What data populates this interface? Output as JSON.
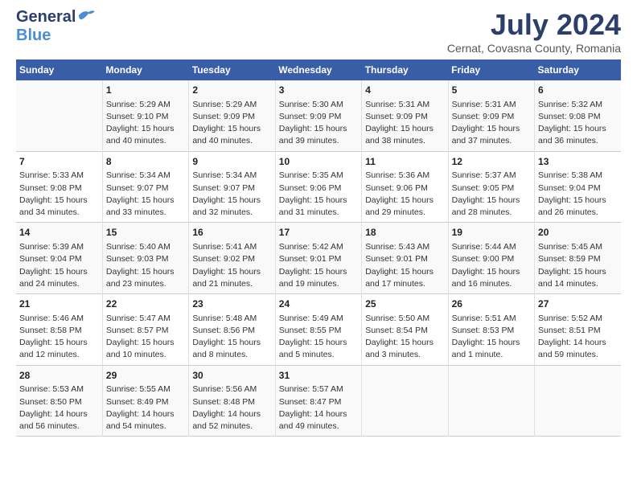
{
  "header": {
    "logo_general": "General",
    "logo_blue": "Blue",
    "title": "July 2024",
    "subtitle": "Cernat, Covasna County, Romania"
  },
  "weekdays": [
    "Sunday",
    "Monday",
    "Tuesday",
    "Wednesday",
    "Thursday",
    "Friday",
    "Saturday"
  ],
  "weeks": [
    [
      {
        "num": "",
        "sunrise": "",
        "sunset": "",
        "daylight": ""
      },
      {
        "num": "1",
        "sunrise": "Sunrise: 5:29 AM",
        "sunset": "Sunset: 9:10 PM",
        "daylight": "Daylight: 15 hours and 40 minutes."
      },
      {
        "num": "2",
        "sunrise": "Sunrise: 5:29 AM",
        "sunset": "Sunset: 9:09 PM",
        "daylight": "Daylight: 15 hours and 40 minutes."
      },
      {
        "num": "3",
        "sunrise": "Sunrise: 5:30 AM",
        "sunset": "Sunset: 9:09 PM",
        "daylight": "Daylight: 15 hours and 39 minutes."
      },
      {
        "num": "4",
        "sunrise": "Sunrise: 5:31 AM",
        "sunset": "Sunset: 9:09 PM",
        "daylight": "Daylight: 15 hours and 38 minutes."
      },
      {
        "num": "5",
        "sunrise": "Sunrise: 5:31 AM",
        "sunset": "Sunset: 9:09 PM",
        "daylight": "Daylight: 15 hours and 37 minutes."
      },
      {
        "num": "6",
        "sunrise": "Sunrise: 5:32 AM",
        "sunset": "Sunset: 9:08 PM",
        "daylight": "Daylight: 15 hours and 36 minutes."
      }
    ],
    [
      {
        "num": "7",
        "sunrise": "Sunrise: 5:33 AM",
        "sunset": "Sunset: 9:08 PM",
        "daylight": "Daylight: 15 hours and 34 minutes."
      },
      {
        "num": "8",
        "sunrise": "Sunrise: 5:34 AM",
        "sunset": "Sunset: 9:07 PM",
        "daylight": "Daylight: 15 hours and 33 minutes."
      },
      {
        "num": "9",
        "sunrise": "Sunrise: 5:34 AM",
        "sunset": "Sunset: 9:07 PM",
        "daylight": "Daylight: 15 hours and 32 minutes."
      },
      {
        "num": "10",
        "sunrise": "Sunrise: 5:35 AM",
        "sunset": "Sunset: 9:06 PM",
        "daylight": "Daylight: 15 hours and 31 minutes."
      },
      {
        "num": "11",
        "sunrise": "Sunrise: 5:36 AM",
        "sunset": "Sunset: 9:06 PM",
        "daylight": "Daylight: 15 hours and 29 minutes."
      },
      {
        "num": "12",
        "sunrise": "Sunrise: 5:37 AM",
        "sunset": "Sunset: 9:05 PM",
        "daylight": "Daylight: 15 hours and 28 minutes."
      },
      {
        "num": "13",
        "sunrise": "Sunrise: 5:38 AM",
        "sunset": "Sunset: 9:04 PM",
        "daylight": "Daylight: 15 hours and 26 minutes."
      }
    ],
    [
      {
        "num": "14",
        "sunrise": "Sunrise: 5:39 AM",
        "sunset": "Sunset: 9:04 PM",
        "daylight": "Daylight: 15 hours and 24 minutes."
      },
      {
        "num": "15",
        "sunrise": "Sunrise: 5:40 AM",
        "sunset": "Sunset: 9:03 PM",
        "daylight": "Daylight: 15 hours and 23 minutes."
      },
      {
        "num": "16",
        "sunrise": "Sunrise: 5:41 AM",
        "sunset": "Sunset: 9:02 PM",
        "daylight": "Daylight: 15 hours and 21 minutes."
      },
      {
        "num": "17",
        "sunrise": "Sunrise: 5:42 AM",
        "sunset": "Sunset: 9:01 PM",
        "daylight": "Daylight: 15 hours and 19 minutes."
      },
      {
        "num": "18",
        "sunrise": "Sunrise: 5:43 AM",
        "sunset": "Sunset: 9:01 PM",
        "daylight": "Daylight: 15 hours and 17 minutes."
      },
      {
        "num": "19",
        "sunrise": "Sunrise: 5:44 AM",
        "sunset": "Sunset: 9:00 PM",
        "daylight": "Daylight: 15 hours and 16 minutes."
      },
      {
        "num": "20",
        "sunrise": "Sunrise: 5:45 AM",
        "sunset": "Sunset: 8:59 PM",
        "daylight": "Daylight: 15 hours and 14 minutes."
      }
    ],
    [
      {
        "num": "21",
        "sunrise": "Sunrise: 5:46 AM",
        "sunset": "Sunset: 8:58 PM",
        "daylight": "Daylight: 15 hours and 12 minutes."
      },
      {
        "num": "22",
        "sunrise": "Sunrise: 5:47 AM",
        "sunset": "Sunset: 8:57 PM",
        "daylight": "Daylight: 15 hours and 10 minutes."
      },
      {
        "num": "23",
        "sunrise": "Sunrise: 5:48 AM",
        "sunset": "Sunset: 8:56 PM",
        "daylight": "Daylight: 15 hours and 8 minutes."
      },
      {
        "num": "24",
        "sunrise": "Sunrise: 5:49 AM",
        "sunset": "Sunset: 8:55 PM",
        "daylight": "Daylight: 15 hours and 5 minutes."
      },
      {
        "num": "25",
        "sunrise": "Sunrise: 5:50 AM",
        "sunset": "Sunset: 8:54 PM",
        "daylight": "Daylight: 15 hours and 3 minutes."
      },
      {
        "num": "26",
        "sunrise": "Sunrise: 5:51 AM",
        "sunset": "Sunset: 8:53 PM",
        "daylight": "Daylight: 15 hours and 1 minute."
      },
      {
        "num": "27",
        "sunrise": "Sunrise: 5:52 AM",
        "sunset": "Sunset: 8:51 PM",
        "daylight": "Daylight: 14 hours and 59 minutes."
      }
    ],
    [
      {
        "num": "28",
        "sunrise": "Sunrise: 5:53 AM",
        "sunset": "Sunset: 8:50 PM",
        "daylight": "Daylight: 14 hours and 56 minutes."
      },
      {
        "num": "29",
        "sunrise": "Sunrise: 5:55 AM",
        "sunset": "Sunset: 8:49 PM",
        "daylight": "Daylight: 14 hours and 54 minutes."
      },
      {
        "num": "30",
        "sunrise": "Sunrise: 5:56 AM",
        "sunset": "Sunset: 8:48 PM",
        "daylight": "Daylight: 14 hours and 52 minutes."
      },
      {
        "num": "31",
        "sunrise": "Sunrise: 5:57 AM",
        "sunset": "Sunset: 8:47 PM",
        "daylight": "Daylight: 14 hours and 49 minutes."
      },
      {
        "num": "",
        "sunrise": "",
        "sunset": "",
        "daylight": ""
      },
      {
        "num": "",
        "sunrise": "",
        "sunset": "",
        "daylight": ""
      },
      {
        "num": "",
        "sunrise": "",
        "sunset": "",
        "daylight": ""
      }
    ]
  ]
}
